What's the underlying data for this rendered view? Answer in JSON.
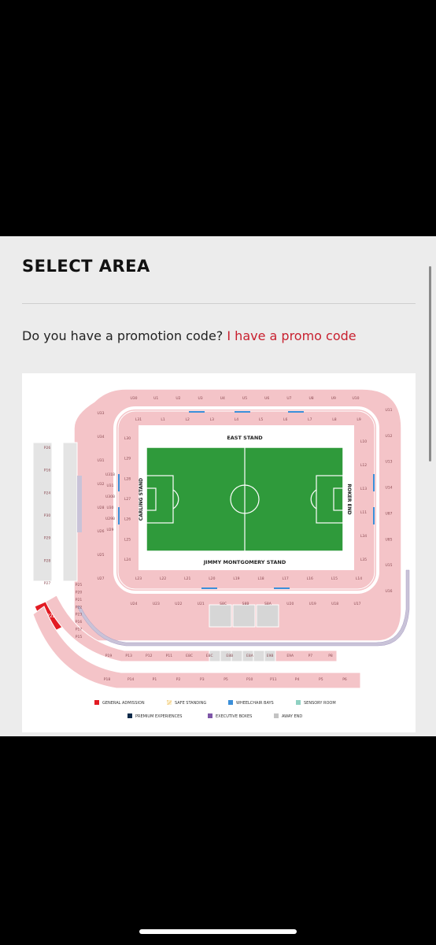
{
  "page": {
    "title": "SELECT AREA",
    "promo_question": "Do you have a promotion code?",
    "promo_link": "I have a promo code"
  },
  "colors": {
    "accent": "#c8202f",
    "seat_section": "#f4c4c8",
    "pitch": "#2f9a3b",
    "general_admission": "#e21b23",
    "premium": "#0d2a4a",
    "wheelchair": "#3b8fd9",
    "executive": "#7e56a8",
    "away": "#c3c3c3",
    "sensory": "#8fd1c2",
    "safe_standing": "#f2c97f"
  },
  "stadium_map": {
    "stands": {
      "east": "EAST STAND",
      "west": "JIMMY MONTGOMERY STAND",
      "carling": "CARLING STAND",
      "roker": "ROKER END"
    },
    "upper_top_row": [
      "U30",
      "U1",
      "U2",
      "U3",
      "U4",
      "U5",
      "U6",
      "U7",
      "U8",
      "U9",
      "U10"
    ],
    "lower_top_row": [
      "L31",
      "L1",
      "L2",
      "L3",
      "L4",
      "L5",
      "L6",
      "L7",
      "L8",
      "L9"
    ],
    "lower_bottom_row": [
      "L23",
      "L22",
      "L21",
      "L20",
      "L19",
      "L18",
      "L17",
      "L16",
      "L15",
      "L14"
    ],
    "upper_bottom_row": [
      "U24",
      "U23",
      "U22",
      "U21",
      "S8C",
      "S8B",
      "S8A",
      "U20",
      "U19",
      "U18",
      "U17"
    ],
    "carling_upper": [
      "U33",
      "U34",
      "U31",
      "U32",
      "U28",
      "U26",
      "U25",
      "U27"
    ],
    "carling_lower": [
      "L30",
      "L29",
      "L28",
      "L27",
      "L26",
      "L25",
      "L24"
    ],
    "carling_boxes": [
      "U31B",
      "U31",
      "U30B",
      "U30",
      "U29B",
      "U29"
    ],
    "roker_upper": [
      "U11",
      "U12",
      "U13",
      "U14",
      "U87",
      "U85",
      "U15",
      "U16"
    ],
    "roker_lower": [
      "L10",
      "L12",
      "L13",
      "L11",
      "L34",
      "L35"
    ],
    "p_upper_row": [
      "P19",
      "P13",
      "P12",
      "P11",
      "E8C",
      "E8C",
      "E8B",
      "E8A",
      "E9B",
      "E9A",
      "P7",
      "P8"
    ],
    "p_lower_row": [
      "P18",
      "P14",
      "P1",
      "P2",
      "P3",
      "P5",
      "P10",
      "P11",
      "P4",
      "P5",
      "P6"
    ],
    "p_left": [
      "P25",
      "P20",
      "P21",
      "P22",
      "P23",
      "P16",
      "P17",
      "P15"
    ],
    "p_far_left": [
      "P26",
      "P16",
      "P24",
      "P30",
      "P29",
      "P28",
      "P27"
    ],
    "general_admission_section": "P22"
  },
  "legend": [
    {
      "label": "GENERAL ADMISSION",
      "color": "#e21b23",
      "icon": "square-icon"
    },
    {
      "label": "SAFE STANDING",
      "color": "#f2c97f",
      "icon": "hatch-icon"
    },
    {
      "label": "WHEELCHAIR BAYS",
      "color": "#3b8fd9",
      "icon": "square-icon"
    },
    {
      "label": "SENSORY ROOM",
      "color": "#8fd1c2",
      "icon": "square-icon"
    },
    {
      "label": "PREMIUM EXPERIENCES",
      "color": "#0d2a4a",
      "icon": "square-icon"
    },
    {
      "label": "EXECUTIVE BOXES",
      "color": "#7e56a8",
      "icon": "square-icon"
    },
    {
      "label": "AWAY END",
      "color": "#c3c3c3",
      "icon": "square-icon"
    }
  ]
}
